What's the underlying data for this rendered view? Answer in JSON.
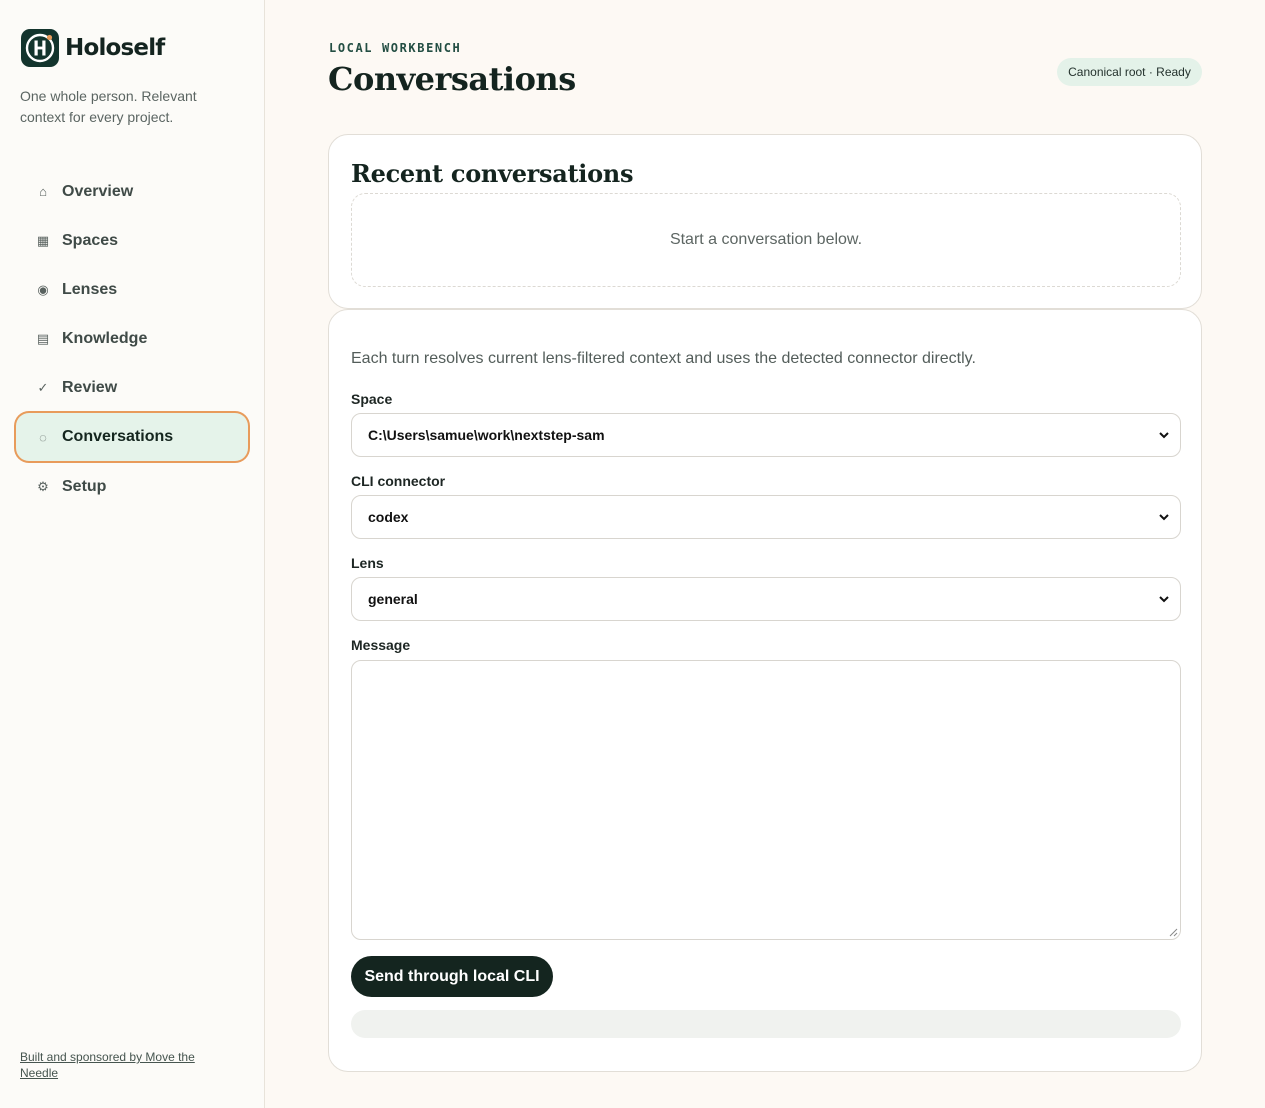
{
  "app": {
    "name": "Holoself",
    "tagline": "One whole person. Relevant context for every project.",
    "footer_link": "Built and sponsored by Move the Needle"
  },
  "sidebar": {
    "items": [
      {
        "label": "Overview",
        "icon": "home-icon",
        "glyph": "⌂"
      },
      {
        "label": "Spaces",
        "icon": "grid-icon",
        "glyph": "▦"
      },
      {
        "label": "Lenses",
        "icon": "lens-icon",
        "glyph": "◉"
      },
      {
        "label": "Knowledge",
        "icon": "document-icon",
        "glyph": "▤"
      },
      {
        "label": "Review",
        "icon": "check-icon",
        "glyph": "✓"
      },
      {
        "label": "Conversations",
        "icon": "conversation-icon",
        "glyph": "◌",
        "active": true
      },
      {
        "label": "Setup",
        "icon": "gear-icon",
        "glyph": "⚙"
      }
    ]
  },
  "header": {
    "eyebrow": "LOCAL WORKBENCH",
    "title": "Conversations",
    "status": "Canonical root · Ready"
  },
  "recent": {
    "title": "Recent conversations",
    "empty": "Start a conversation below."
  },
  "form": {
    "help": "Each turn resolves current lens-filtered context and uses the detected connector directly.",
    "space_label": "Space",
    "space_value": "C:\\Users\\samue\\work\\nextstep-sam",
    "connector_label": "CLI connector",
    "connector_value": "codex",
    "lens_label": "Lens",
    "lens_value": "general",
    "message_label": "Message",
    "message_value": "",
    "send_label": "Send through local CLI"
  },
  "colors": {
    "accent": "#13342d",
    "active_bg": "#e5f3ea",
    "active_ring": "#e89b5b",
    "background": "#fdf9f4"
  }
}
